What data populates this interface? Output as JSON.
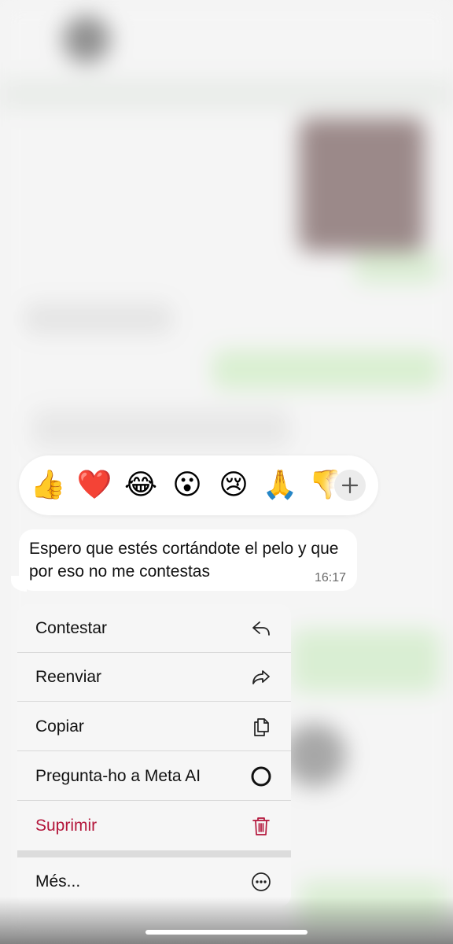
{
  "reactions": [
    {
      "emoji": "👍",
      "name": "thumbs-up"
    },
    {
      "emoji": "❤️",
      "name": "red-heart"
    },
    {
      "emoji": "😂",
      "name": "tears-of-joy"
    },
    {
      "emoji": "😮",
      "name": "surprised"
    },
    {
      "emoji": "😢",
      "name": "crying"
    },
    {
      "emoji": "🙏",
      "name": "folded-hands"
    },
    {
      "emoji": "👎",
      "name": "thumbs-down"
    }
  ],
  "add_reaction_icon": "plus-icon",
  "message": {
    "text": "Espero que estés cortándote el pelo y que por eso no me contestas",
    "time": "16:17"
  },
  "menu": {
    "items": [
      {
        "label": "Contestar",
        "icon": "reply-icon"
      },
      {
        "label": "Reenviar",
        "icon": "forward-icon"
      },
      {
        "label": "Copiar",
        "icon": "copy-icon"
      },
      {
        "label": "Pregunta-ho a Meta AI",
        "icon": "meta-ai-icon"
      },
      {
        "label": "Suprimir",
        "icon": "trash-icon",
        "destructive": true
      }
    ],
    "more": {
      "label": "Més...",
      "icon": "more-icon"
    }
  },
  "colors": {
    "destructive": "#b3153a",
    "menu_background": "#f6f6f6",
    "bubble_background": "#ffffff"
  }
}
